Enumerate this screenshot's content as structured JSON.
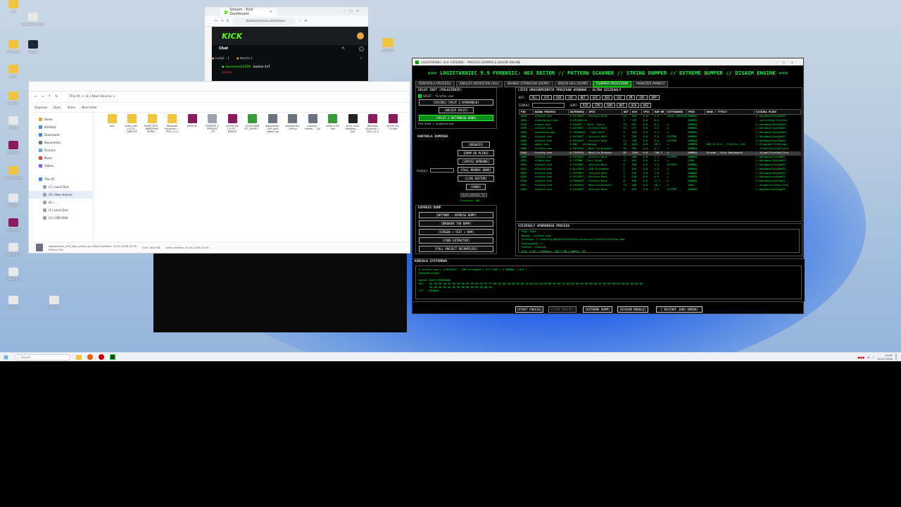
{
  "desktop": {
    "icons": [
      {
        "label": "gry",
        "color": "#f2c43d"
      },
      {
        "label": "DeluxeBox_V69_m...",
        "color": "#e8e8e8"
      },
      {
        "label": "Aplikacje",
        "color": "#f2c43d"
      },
      {
        "label": "Steam",
        "color": "#1b2838"
      },
      {
        "label": "Kosz",
        "color": "#f2c43d"
      },
      {
        "label": "Skrypty",
        "color": "#f2c43d"
      },
      {
        "label": "Adobe",
        "color": "#e8e8e8"
      },
      {
        "label": "WinRAR",
        "color": "#8b1a5c"
      },
      {
        "label": "Nowy folder",
        "color": "#f2c43d"
      },
      {
        "label": "logisty",
        "color": "#e8e8e8"
      },
      {
        "label": "WinRAR 2",
        "color": "#8b1a5c"
      },
      {
        "label": "Dokument",
        "color": "#e8e8e8"
      },
      {
        "label": "Notatki",
        "color": "#e8e8e8"
      },
      {
        "label": "Raport",
        "color": "#e8e8e8"
      },
      {
        "label": "Eksport",
        "color": "#e8e8e8"
      }
    ],
    "folder_label": "Gotowe"
  },
  "browser": {
    "tab_title": "Stream - Kick Dashboard",
    "address": "dashboard.kick.com/stream",
    "brand": "KICK",
    "chat_title": "Chat",
    "chat_user_a": "Luckyl...",
    "chat_user_b": "lworms",
    "chat_user_a_count": "1",
    "chat_user_b_count": "1",
    "chat_message_user": "alonsmock1200:",
    "chat_message_text": "będzie ileT",
    "chat_message_second": "lolololo"
  },
  "explorer": {
    "ribbon": [
      "Organize",
      "Open",
      "Share",
      "New folder"
    ],
    "path": "This PC  >  (E:) New Volume  >",
    "nav": [
      {
        "label": "Home",
        "color": "#e8a33c"
      },
      {
        "label": "Desktop",
        "color": "#4a90e2"
      },
      {
        "label": "Downloads",
        "color": "#3b82f6"
      },
      {
        "label": "Documents",
        "color": "#6b7280"
      },
      {
        "label": "Pictures",
        "color": "#60a5fa"
      },
      {
        "label": "Music",
        "color": "#ef4444"
      },
      {
        "label": "Videos",
        "color": "#8b5cf6"
      },
      {
        "label": "This PC",
        "color": "#3b82f6"
      },
      {
        "label": "(C:) Local Disk",
        "color": "#9ca3af"
      },
      {
        "label": "(D:) New Volume",
        "color": "#9ca3af"
      },
      {
        "label": "(E:) ...",
        "color": "#9ca3af"
      },
      {
        "label": "(F:) Local Disk",
        "color": "#9ca3af"
      },
      {
        "label": "(G:) USB DISK",
        "color": "#9ca3af"
      }
    ],
    "files": [
      {
        "label": "dist",
        "color": "#f2c43d"
      },
      {
        "label": "install_Wa... 1.0.53 ... ABACUS",
        "color": "#f2c43d"
      },
      {
        "label": "DUMP_RES... WINDOWS MONO...",
        "color": "#f2c43d"
      },
      {
        "label": "Windows Ukrainian ... PRO_v1.0",
        "color": "#f2c43d"
      },
      {
        "label": "AIDe.rar",
        "color": "#8b1a5c"
      },
      {
        "label": "DUMPER_F ORENSIC ...PY",
        "color": "#9ca3af"
      },
      {
        "label": "install_Wa 1.0.53 ... BAKOS",
        "color": "#8b1a5c"
      },
      {
        "label": "LOGISTARN IEC_DUMP ...",
        "color": "#3a9a3a"
      },
      {
        "label": "logistarniec _v99_split _admin.py",
        "color": "#6b7280"
      },
      {
        "label": "logistarniec _v99.py",
        "color": "#6b7280"
      },
      {
        "label": "process_ viewer_ ...py",
        "color": "#6b7280"
      },
      {
        "label": "sitfax 4.55 .exe",
        "color": "#3a9a3a"
      },
      {
        "label": "whip_mind software_ ... Exe",
        "color": "#222222"
      },
      {
        "label": "Windows Ukrainian ... PRO_v1.0",
        "color": "#8b1a5c"
      },
      {
        "label": "winrar_64 7.0.exe",
        "color": "#8b1a5c"
      }
    ],
    "status_name": "logistarniec_v99_split_admin.py  Date modified: 15-03-2026 20:30",
    "status_type": "Python File",
    "status_size": "Size: 56,6 KB",
    "status_created": "Date created: 15-03-2026 20:30"
  },
  "forensic": {
    "titlebar": "LOGISTARNIEC v9.9: FORENSIC - PROCESS DUMPER & DISASM ENGINE",
    "header": ">>> LOGISTARNIEC 9.9 FORENSIC: HEX EDITOR // PATTERN SCANNER // STRING DUMPER // EXTREME DUMPER // DISASM ENGINE <<<",
    "tabs": [
      "KONTROLA PROCESU",
      "ANALIZA WZORCOW (SIG)",
      "SKANER STRINGOW (DUMP)",
      "WIDOK HEX (DUMP)",
      "DUMPER PROCESOW",
      "MANAZER PAMIECI"
    ],
    "active_tab": 4,
    "split": {
      "title": "SPLOT INIT (POLACZENIE)",
      "checkbox_label": "SPLOT: firefox.exe",
      "btn_start": "[ZACZNIJ SPLOT Z WYBRANEGO]",
      "btn_release": "[ODCZEP SPLOT]",
      "btn_active": "[SPLOT Z AKTYWNEGO OKNA]",
      "pid_label": "PID:5564 | notDetected"
    },
    "dumper_control": {
      "title": "KONTROLA DUMPERA",
      "buttons": [
        "[ODSWIEZ]",
        "[DUMP DO PLIKU]",
        "[ZAPISZ WYBRANE]",
        "[FULL MEMORY DUMP]",
        "[LIVE EDITOR]",
        "[OKNO]"
      ],
      "search_label": "Szukaj:",
      "auto_refresh": "Auto-odswiez 1s",
      "processes_label": "Procesow: 106"
    },
    "express": {
      "title": "EXPRESS DUMP",
      "buttons": [
        "[AKTYWNY - EXPRESS DUMP]",
        "[BROWSER TAB DUMP]",
        "[SCREEN + TEXT + RAM]",
        "[CODE EXTRACTOR]",
        "[FULL PROJECT DECOMPILER]"
      ]
    },
    "list": {
      "title": "LISTA URUCHOMIONYCH PROCESOW WINDOWS - ULTRA SZCZEGOLY",
      "filter_label": "KAT:",
      "filter_chips": [
        "ALL",
        "SYS",
        "USR",
        "SVC",
        "NET",
        "GUI",
        "DEV",
        "SEC",
        "VM",
        "GPU",
        "APP"
      ],
      "search_label": "SZUKAJ:",
      "sort_label": "SORT:",
      "sort_chips": [
        "PID",
        "CPU",
        "RAM",
        "WAT",
        "UCH",
        "NAZ"
      ],
      "columns": [
        "PID",
        "NAZWA PROCESU",
        "KATEGORIA / OPIS",
        "WAT",
        "UCH",
        "CPU%",
        "RAM MB",
        "UZYTKOWNIK",
        "PRIO",
        "OKNO / TYTULY",
        "SCIEZKA PLIKU"
      ],
      "rows": [
        [
          "4018",
          "svchost.exe",
          "@ SVCHOST - Service Host",
          "13",
          "184",
          "0.0",
          "5.4",
          "LOCAL SERVICE",
          "NORMAL",
          "-",
          "C:\\Windows\\System32"
        ],
        [
          "4636",
          "crashhelper.exe",
          "@ APLIKACJA",
          "3",
          "239",
          "0.0",
          "0.0",
          "",
          "NORMAL",
          "-",
          "...p\\firefox\\firefox"
        ],
        [
          "4718",
          "sihost.exe",
          "@ SIHOST - Shell Infra",
          "13",
          "987",
          "0.0",
          "6.1",
          "v",
          "NORMAL",
          "-",
          "C:\\Windows\\System32"
        ],
        [
          "4790",
          "svchost.exe",
          "@ SVCHOST - Service Host",
          "11",
          "257",
          "0.0",
          "2.2",
          "v",
          "NORMAL",
          "-",
          "C:\\Windows\\System32"
        ],
        [
          "4804",
          "taskhostw.exe",
          "@ TASKHOST - Task Host",
          "5",
          "158",
          "0.0",
          "4.3",
          "v",
          "NORMAL",
          "-",
          "C:\\Windows\\System32"
        ],
        [
          "4846",
          "svchost.exe",
          "@ SVCHOST - Service Host",
          "6",
          "156",
          "0.0",
          "1.9",
          "SYSTEM",
          "NORMAL",
          "-",
          "C:\\Windows\\System32"
        ],
        [
          "5020",
          "svchost.exe",
          "@ SVCHOST - Service Host",
          "13",
          "258",
          "0.0",
          "5.6",
          "SYSTEM",
          "NORMAL",
          "-",
          "C:\\Windows\\System32"
        ],
        [
          "5284",
          "obs64.exe",
          "@ OBS - Streaming",
          "49",
          "2051",
          "0.0",
          "59.2",
          "v",
          "NORMAL",
          "OBS 32.0.4 - Profile: Unt",
          "C:\\Program Files\\obs"
        ],
        [
          "5306",
          "firefox.exe",
          "@ FIREFOX - Mozilla Browser",
          "20",
          "399",
          "0.0",
          "6.7",
          "v",
          "NORMAL",
          "-",
          "...b\\apt\\firefox\\fire"
        ],
        [
          "5564",
          "firefox.exe",
          "@ FIREFOX - Mozilla Browser",
          "82",
          "1954",
          "0.0",
          "748.7",
          "v",
          "NORMAL",
          "Stream - Kick Dashboard",
          "...b\\apt\\firefox\\fire"
        ],
        [
          "5608",
          "svchost.exe",
          "@ SVCHOST - Service Host",
          "3",
          "200",
          "0.0",
          "1.1",
          "SYSTEM",
          "NORMAL",
          "-",
          "C:\\Windows\\System32"
        ],
        [
          "5692",
          "ctfmon.exe",
          "@ CTFMON - Text Input",
          "11",
          "441",
          "0.0",
          "0.4",
          "v",
          "HIGH",
          "-",
          "C:\\Windows\\System32"
        ],
        [
          "5694",
          "svchost.exe",
          "@ SVCHOST - Service Host",
          "6",
          "168",
          "0.0",
          "1.9",
          "SYSTEM",
          "NORMAL",
          "-",
          "C:\\Windows\\System32"
        ],
        [
          "6012",
          "dllhost.exe",
          "@ DLLHOST - COM Surrogate",
          "5",
          "164",
          "0.0",
          "1.3",
          "v",
          "NORMAL",
          "-",
          "C:\\Windows\\System32"
        ],
        [
          "6052",
          "svchost.exe",
          "@ SVCHOST - Service Host",
          "7",
          "216",
          "0.0",
          "1.8",
          "v",
          "NORMAL",
          "-",
          "C:\\Windows\\System32"
        ],
        [
          "6144",
          "svchost.exe",
          "@ SVCHOST - Service Host",
          "5",
          "128",
          "0.0",
          "0.9",
          "v",
          "NORMAL",
          "-",
          "C:\\Windows\\System32"
        ],
        [
          "6244",
          "conhost.exe",
          "@ CONHOST - Console Host",
          "8",
          "195",
          "0.0",
          "17.1",
          "v",
          "NORMAL",
          "-",
          "C:\\Windows\\System32"
        ],
        [
          "6351",
          "firefox.exe",
          "@ FIREFOX - Mozilla Browser",
          "25",
          "508",
          "0.0",
          "48.1",
          "v",
          "IDLE",
          "-",
          "...b\\apt\\firefox\\fire"
        ],
        [
          "6402",
          "svchost.exe",
          "@ SVCHOST - Service Host",
          "4",
          "133",
          "0.0",
          "1.2",
          "SYSTEM",
          "NORMAL",
          "-",
          "C:\\Windows\\System32"
        ]
      ],
      "selected_row": 9
    },
    "details": {
      "title": "SZCZEGOLY WYBRANEGO PROCESU",
      "lines": [
        "PID: 5564",
        "Nazwa: firefox.exe",
        "Sciezka: C:\\Users\\x\\Desktop\\firefox\\forensic\\firefox\\firefox.exe",
        "Uzytkownik: v",
        "Status: running",
        "CPU: 0.0% | Pamiec: 748.7 MB | Watki: 82"
      ]
    },
    "console": {
      "title": "KONSOLA SYSTEMOWA",
      "lines": [
        "@ dllhost.exe | @ DLLHOST - COM Surrogate | # 5 %100 | # NORMAL | dtk | ...",
        "Podglad bloku:",
        "",
        "Adres: 0x07ff00000000",
        "HEX  : 4D 5A 90 00 03 00 00 00 04 00 00 00 FF FF 00 00 B8 00 00 00 00 00 00 00 40 00 00 00 00 00 00 00 00 00 00 00 00 00 00 00 00 00 00 00 00 00 00",
        "       00 00 00 00 00 00 00 00 00 00 00 00 00 00",
        "TXT  : MZ@@@@"
      ]
    },
    "bottom_buttons": [
      "[START FREEZE]",
      "[STOP FREEZE]",
      "[EXTREME DUMP]",
      "[DISASM MODULE]",
      "[ RESTART JAKO ADMIN]"
    ]
  },
  "taskbar": {
    "search_placeholder": "Search",
    "time": "19:43",
    "date": "15-03-2026"
  }
}
